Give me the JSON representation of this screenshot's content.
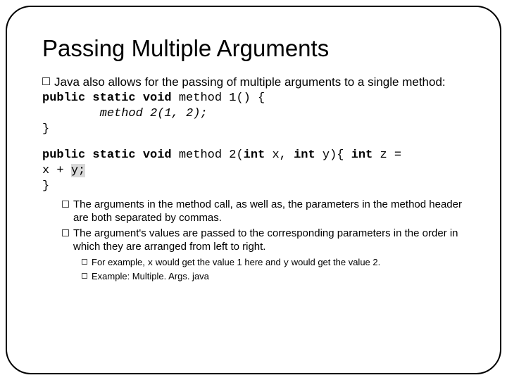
{
  "title": "Passing Multiple Arguments",
  "bullet1": "Java also allows for the passing of multiple arguments to a single method:",
  "code1": {
    "sig_kw": "public static void",
    "sig_rest": " method 1() {",
    "call": "        method 2(1, 2);",
    "close": "}"
  },
  "code2": {
    "sig_kw": "public static void",
    "sig_rest1": " method 2(",
    "sig_kw2": "int",
    "sig_rest2": " x, ",
    "sig_kw3": "int",
    "sig_rest3": " y){ ",
    "sig_kw4": "int",
    "sig_rest4": " z = ",
    "body1": "x + ",
    "body_hl": "y;",
    "close": "}"
  },
  "sub1": "The arguments in the method call, as well as, the parameters in the method header are both separated by commas.",
  "sub2": "The argument's values are passed to the corresponding parameters in the order in which they are arranged from left to right.",
  "subsub1_a": "For example, ",
  "subsub1_x": "x",
  "subsub1_b": " would get the value 1 here and ",
  "subsub1_y": "y",
  "subsub1_c": " would get the value 2.",
  "subsub2": "Example:  Multiple. Args. java"
}
